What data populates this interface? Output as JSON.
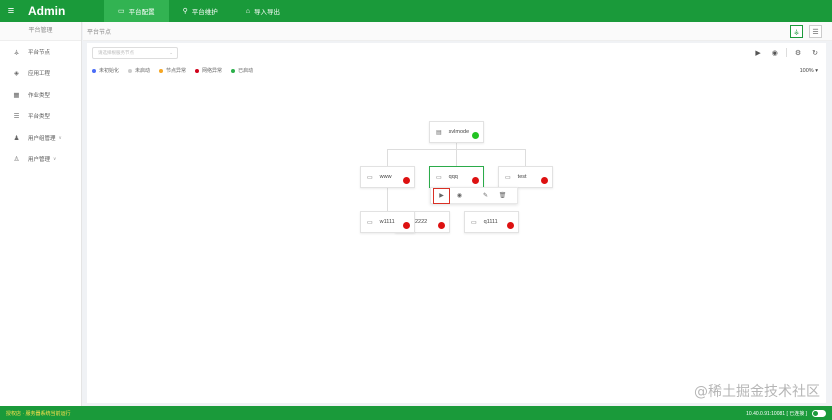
{
  "app": {
    "title": "Admin"
  },
  "topnav": [
    {
      "label": "平台配置",
      "icon": "monitor-icon",
      "active": true
    },
    {
      "label": "平台维护",
      "icon": "wrench-icon",
      "active": false
    },
    {
      "label": "导入导出",
      "icon": "home-icon",
      "active": false
    }
  ],
  "sidebar": {
    "title": "平台管理",
    "items": [
      {
        "label": "平台节点",
        "icon": "tree-icon",
        "chevron": ""
      },
      {
        "label": "应用工程",
        "icon": "cube-icon",
        "chevron": ""
      },
      {
        "label": "作业类型",
        "icon": "grid-icon",
        "chevron": ""
      },
      {
        "label": "平台类型",
        "icon": "list-icon",
        "chevron": ""
      },
      {
        "label": "用户组管理",
        "icon": "users-icon",
        "chevron": "∨"
      },
      {
        "label": "用户管理",
        "icon": "user-icon",
        "chevron": "∨"
      }
    ]
  },
  "breadcrumb": "平台节点",
  "toolbar": {
    "search_placeholder": "请选择根服务节点"
  },
  "legend": [
    {
      "label": "未初始化",
      "color": "#4a6cf7"
    },
    {
      "label": "未启动",
      "color": "#cccccc"
    },
    {
      "label": "节点异常",
      "color": "#f5a623"
    },
    {
      "label": "网络异常",
      "color": "#d0021b"
    },
    {
      "label": "已启动",
      "color": "#2bb04a"
    }
  ],
  "zoom": {
    "value": "100%",
    "chevron": "▾"
  },
  "colors": {
    "online": "#22c322",
    "offline": "#dd1111",
    "brand": "#1a9a3a"
  },
  "nodes": {
    "root": {
      "label": "svlmode",
      "status": "online"
    },
    "www": {
      "label": "www",
      "status": "offline"
    },
    "qqq": {
      "label": "qqq",
      "status": "offline"
    },
    "test": {
      "label": "test",
      "status": "offline"
    },
    "w1111": {
      "label": "w1111",
      "status": "offline"
    },
    "n2222": {
      "label": "2222",
      "status": "offline"
    },
    "q1111": {
      "label": "q1111",
      "status": "offline"
    }
  },
  "footer": {
    "left": "授权店 · 服务器系统当前运行",
    "right": "10.40.0.91:10081 [ 已连接 ]"
  },
  "watermark": "@稀土掘金技术社区"
}
